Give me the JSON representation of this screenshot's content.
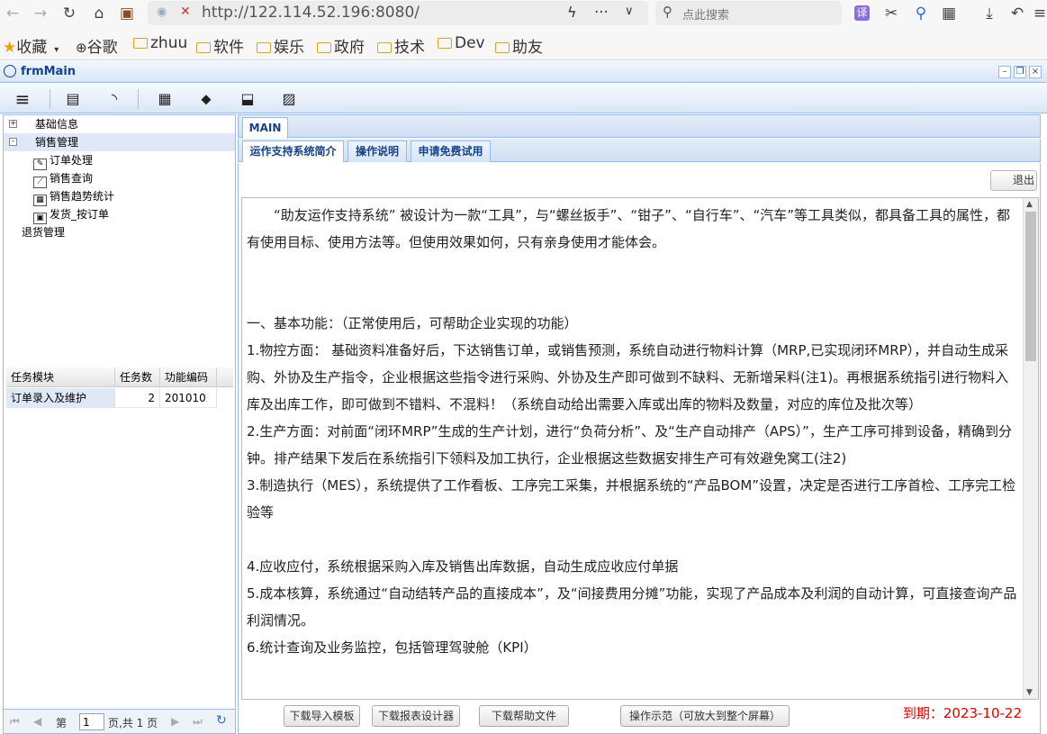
{
  "browser": {
    "url": "http://122.114.52.196:8080/",
    "search_placeholder": "点此搜索",
    "translate_label": "译"
  },
  "bookmarks": {
    "favorites": "收藏",
    "items": [
      "谷歌",
      "zhuu",
      "软件",
      "娱乐",
      "政府",
      "技术",
      "Dev",
      "助友"
    ]
  },
  "app": {
    "title": "frmMain"
  },
  "tree": {
    "items": [
      {
        "label": "基础信息",
        "toggle": "+"
      },
      {
        "label": "销售管理",
        "toggle": "-"
      },
      {
        "label": "订单处理"
      },
      {
        "label": "销售查询"
      },
      {
        "label": "销售趋势统计"
      },
      {
        "label": "发货_按订单"
      },
      {
        "label": "退货管理"
      }
    ]
  },
  "task_grid": {
    "columns": [
      "任务模块",
      "任务数",
      "功能编码"
    ],
    "rows": [
      {
        "module": "订单录入及维护",
        "count": "2",
        "code": "201010"
      }
    ]
  },
  "pager": {
    "page_prefix": "第",
    "page_value": "1",
    "page_suffix": "页,共 1 页"
  },
  "tabs": {
    "main": "MAIN",
    "sub": [
      "运作支持系统简介",
      "操作说明",
      "申请免费试用"
    ]
  },
  "exit_label": "退出",
  "document": {
    "paragraphs": [
      "　　“助友运作支持系统” 被设计为一款“工具”，与“螺丝扳手”、“钳子”、“自行车”、“汽车”等工具类似，都具备工具的属性，都有使用目标、使用方法等。但使用效果如何，只有亲身使用才能体会。",
      "",
      "",
      "一、基本功能：（正常使用后，可帮助企业实现的功能）",
      "1.物控方面： 基础资料准备好后，下达销售订单，或销售预测，系统自动进行物料计算（MRP,已实现闭环MRP），并自动生成采购、外协及生产指令，企业根据这些指令进行采购、外协及生产即可做到不缺料、无新增呆料(注1)。再根据系统指引进行物料入库及出库工作，即可做到不错料、不混料！（系统自动给出需要入库或出库的物料及数量，对应的库位及批次等）",
      "2.生产方面：对前面“闭环MRP”生成的生产计划，进行“负荷分析”、及“生产自动排产（APS）”，生产工序可排到设备，精确到分钟。排产结果下发后在系统指引下领料及加工执行，企业根据这些数据安排生产可有效避免窝工(注2)",
      "3.制造执行（MES），系统提供了工作看板、工序完工采集，并根据系统的“产品BOM”设置，决定是否进行工序首检、工序完工检验等",
      "",
      "4.应收应付，系统根据采购入库及销售出库数据，自动生成应收应付单据",
      "5.成本核算，系统通过“自动结转产品的直接成本”，及“间接费用分摊”功能，实现了产品成本及利润的自动计算，可直接查询产品利润情况。",
      "6.统计查询及业务监控，包括管理驾驶舱（KPI）"
    ]
  },
  "bottom_buttons": [
    "下载导入模板",
    "下载报表设计器",
    "下载帮助文件",
    "操作示范（可放大到整个屏幕）"
  ],
  "expiry": "到期：2023-10-22"
}
